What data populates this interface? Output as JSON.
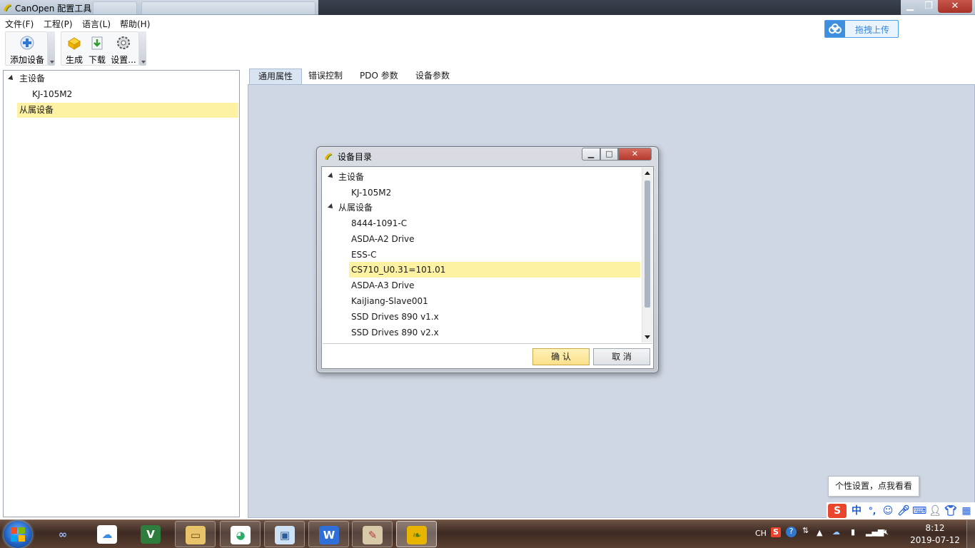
{
  "window": {
    "title": "CanOpen 配置工具",
    "min": "▁",
    "max": "❐",
    "close": "✕"
  },
  "menu": [
    "文件(F)",
    "工程(P)",
    "语言(L)",
    "帮助(H)"
  ],
  "toolbar": {
    "add_device": "添加设备",
    "generate": "生成",
    "download": "下载",
    "settings": "设置..."
  },
  "upload": {
    "label": "拖拽上传"
  },
  "tree": {
    "master": "主设备",
    "master_child": "KJ-105M2",
    "slave": "从属设备"
  },
  "tabs": [
    "通用属性",
    "错误控制",
    "PDO 参数",
    "设备参数"
  ],
  "dialog": {
    "title": "设备目录",
    "master": "主设备",
    "master_child": "KJ-105M2",
    "slave": "从属设备",
    "slave_items": [
      "8444-1091-C",
      "ASDA-A2 Drive",
      "ESS-C",
      "CS710_U0.31=101.01",
      "ASDA-A3 Drive",
      "KaiJiang-Slave001",
      "SSD Drives 890 v1.x",
      "SSD Drives 890 v2.x"
    ],
    "selected_index": 3,
    "ok": "确 认",
    "cancel": "取 消"
  },
  "tooltip": "个性设置，点我看看",
  "ime": {
    "lang_mode": "中",
    "punct": "°,",
    "lang": "CH"
  },
  "clock": {
    "time": "8:12",
    "date": "2019-07-12"
  },
  "colors": {
    "selection": "#fdf1a4",
    "tab_body": "#d0d7e4",
    "accent": "#3f8fe0"
  }
}
